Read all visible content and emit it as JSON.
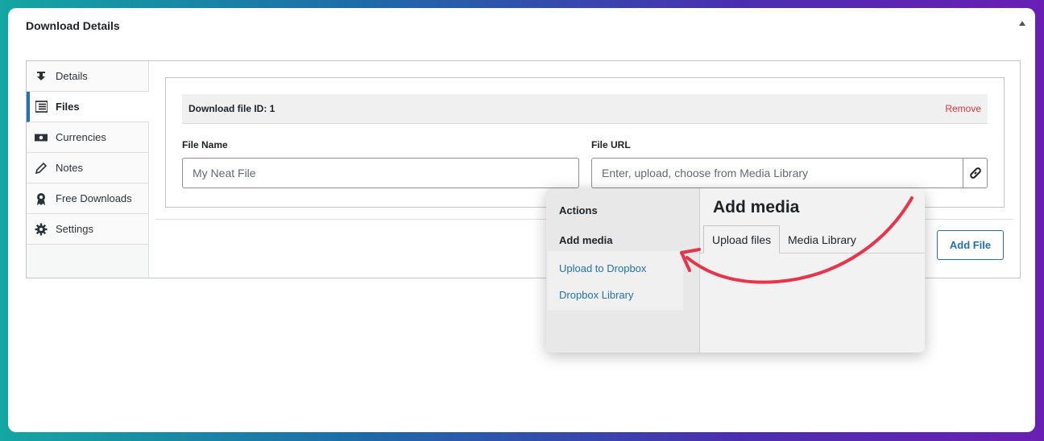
{
  "panel": {
    "title": "Download Details"
  },
  "tabs": [
    {
      "label": "Details",
      "icon": "download-icon"
    },
    {
      "label": "Files",
      "icon": "list-icon",
      "active": true
    },
    {
      "label": "Currencies",
      "icon": "money-icon"
    },
    {
      "label": "Notes",
      "icon": "pencil-icon"
    },
    {
      "label": "Free Downloads",
      "icon": "award-icon"
    },
    {
      "label": "Settings",
      "icon": "gear-icon"
    }
  ],
  "file": {
    "header": "Download file ID: 1",
    "remove": "Remove",
    "name_label": "File Name",
    "name_placeholder": "My Neat File",
    "url_label": "File URL",
    "url_placeholder": "Enter, upload, choose from Media Library"
  },
  "add_file": "Add File",
  "popup": {
    "actions": "Actions",
    "add_media": "Add media",
    "menu": [
      "Upload to Dropbox",
      "Dropbox Library"
    ],
    "title": "Add media",
    "tabs": [
      "Upload files",
      "Media Library"
    ]
  },
  "colors": {
    "accent": "#2271b1",
    "remove": "#d63638",
    "arrow": "#e8334a"
  }
}
